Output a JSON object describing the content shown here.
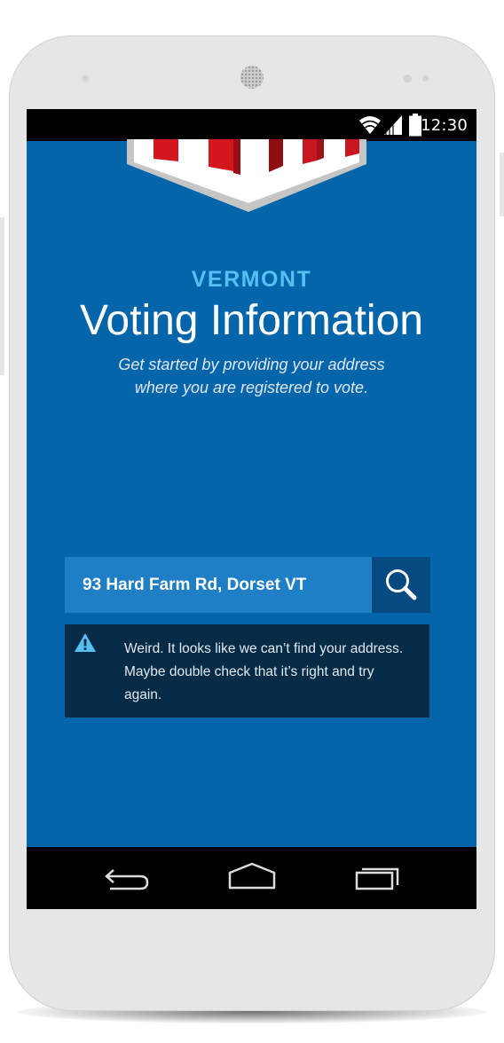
{
  "status_bar": {
    "time": "12:30",
    "icons": [
      "wifi-icon",
      "signal-icon",
      "battery-icon"
    ]
  },
  "header": {
    "state_name": "VERMONT",
    "title": "Voting Information",
    "subtitle_line1": "Get started by providing your address",
    "subtitle_line2": "where you are registered to vote."
  },
  "search": {
    "address_value": "93 Hard Farm Rd, Dorset VT",
    "button_icon": "search-icon"
  },
  "alert": {
    "icon": "warning-icon",
    "line1": "Weird. It looks like we can’t find your address.",
    "line2": "Maybe double check that it’s right and try",
    "line3": "again."
  },
  "nav_bar": {
    "icons": [
      "back-icon",
      "home-icon",
      "recent-apps-icon"
    ]
  },
  "colors": {
    "background": "#0565ab",
    "accent": "#55c1f3",
    "search_field": "#1e7ec6",
    "search_button": "#054a80",
    "alert_background": "#062b46"
  }
}
